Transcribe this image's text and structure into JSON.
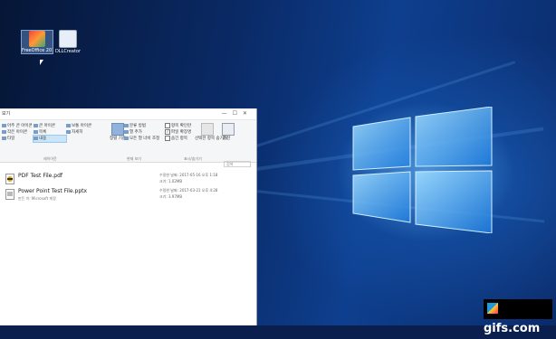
{
  "desktop": {
    "icons": [
      {
        "label": "FreeOffice 2016 Installer",
        "icon": "installer-icon",
        "selected": true
      },
      {
        "label": "DLLCreator",
        "icon": "app-icon",
        "selected": false
      }
    ]
  },
  "explorer": {
    "title": "보기",
    "window_controls": {
      "minimize": "—",
      "maximize": "☐",
      "close": "✕"
    },
    "ribbon": {
      "layout_items": [
        "아주 큰 아이콘",
        "큰 아이콘",
        "보통 아이콘",
        "작은 아이콘",
        "목록",
        "자세히",
        "타일",
        "내용"
      ],
      "selected_layout": "내용",
      "layout_group": "레이아웃",
      "sort_label": "정렬 기준",
      "group_by": "분류 방법",
      "add_columns": "열 추가",
      "size_columns": "모든 열 너비 조정",
      "current_view_group": "현재 보기",
      "checkboxes": [
        {
          "label": "항목 확인란",
          "checked": false
        },
        {
          "label": "파일 확장명",
          "checked": true
        },
        {
          "label": "숨긴 항목",
          "checked": false
        }
      ],
      "hide_selected": "선택한 항목 숨기기",
      "options": "옵션",
      "show_hide_group": "표시/숨기기"
    },
    "search_placeholder": "검색",
    "files": [
      {
        "name": "PDF Test File.pdf",
        "type": "",
        "modified": "수정한 날짜: 2017-05-16 오후 1:18",
        "size": "크기: 1.02MB",
        "icon": "pdf-file-icon"
      },
      {
        "name": "Power Point Test File.pptx",
        "type": "만든 이: Microsoft 계정",
        "modified": "수정한 날짜: 2017-03-21 오후 4:28",
        "size": "크기: 3.97MB",
        "icon": "pptx-file-icon"
      }
    ]
  },
  "watermark": {
    "text": "gifs.com"
  }
}
